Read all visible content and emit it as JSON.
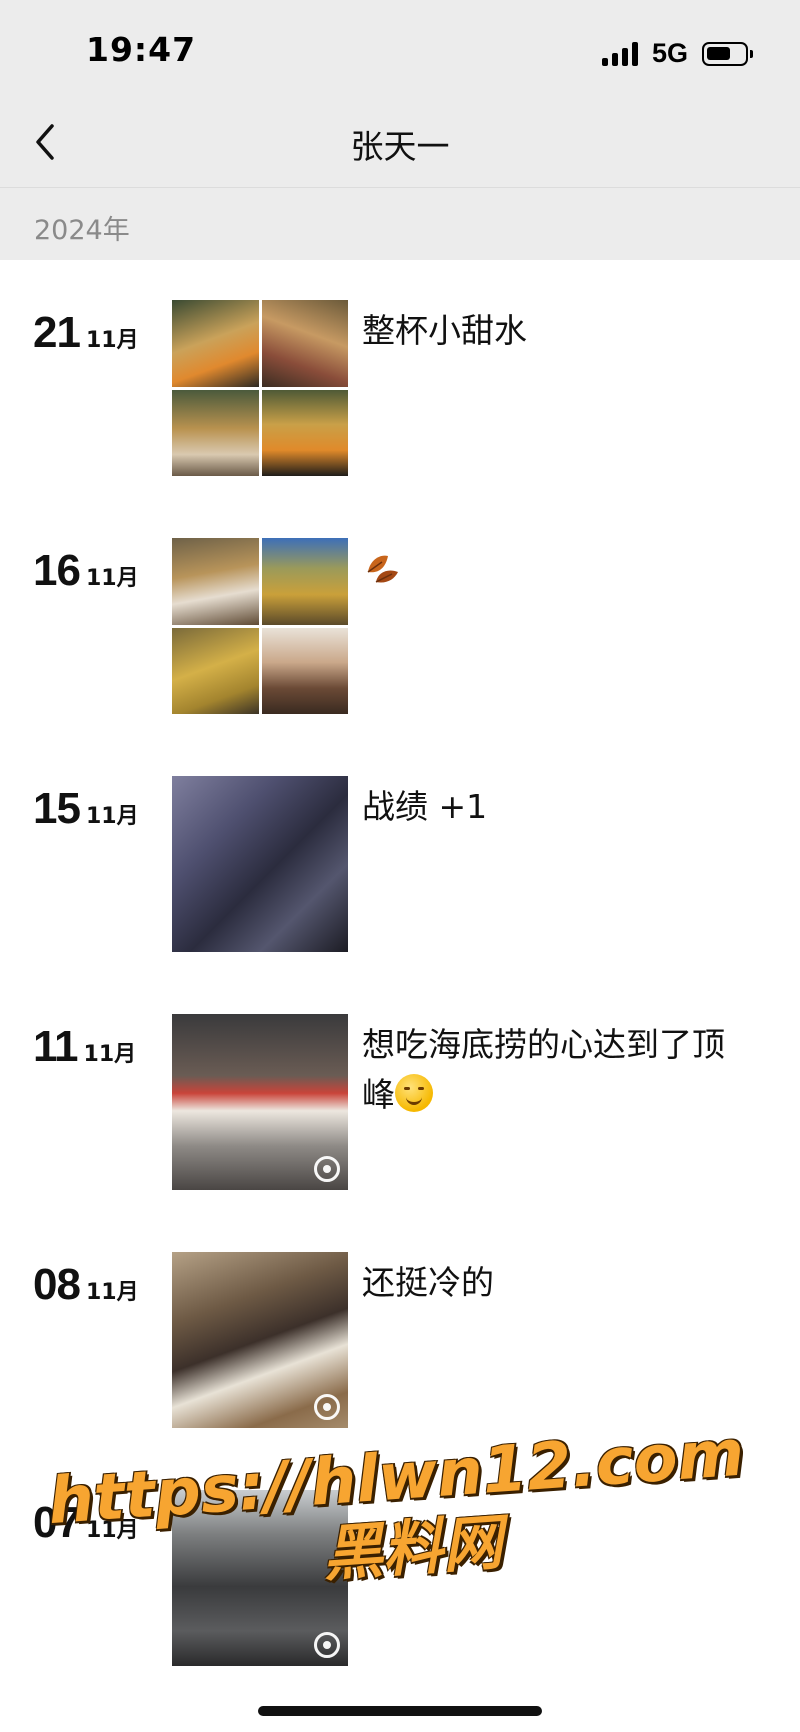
{
  "status_bar": {
    "time": "19:47",
    "network": "5G"
  },
  "nav": {
    "title": "张天一"
  },
  "year_label": "2024年",
  "posts": [
    {
      "day": "21",
      "month": "11月",
      "caption": "整杯小甜水",
      "photos": 4
    },
    {
      "day": "16",
      "month": "11月",
      "caption": "",
      "caption_icon": "autumn-leaves-icon",
      "photos": 4
    },
    {
      "day": "15",
      "month": "11月",
      "caption": "战绩 +1",
      "photos": 1
    },
    {
      "day": "11",
      "month": "11月",
      "caption": "想吃海底捞的心达到了顶峰",
      "caption_icon": "smiling-face-icon",
      "photos": 1,
      "live": true
    },
    {
      "day": "08",
      "month": "11月",
      "caption": "还挺冷的",
      "photos": 1,
      "live": true
    },
    {
      "day": "07",
      "month": "11月",
      "caption": "",
      "photos": 1,
      "live": true
    }
  ],
  "watermark": {
    "url": "https://hlwn12.com",
    "name": "黑料网"
  },
  "colors": {
    "header_bg": "#ececec",
    "watermark": "#f7a531"
  }
}
